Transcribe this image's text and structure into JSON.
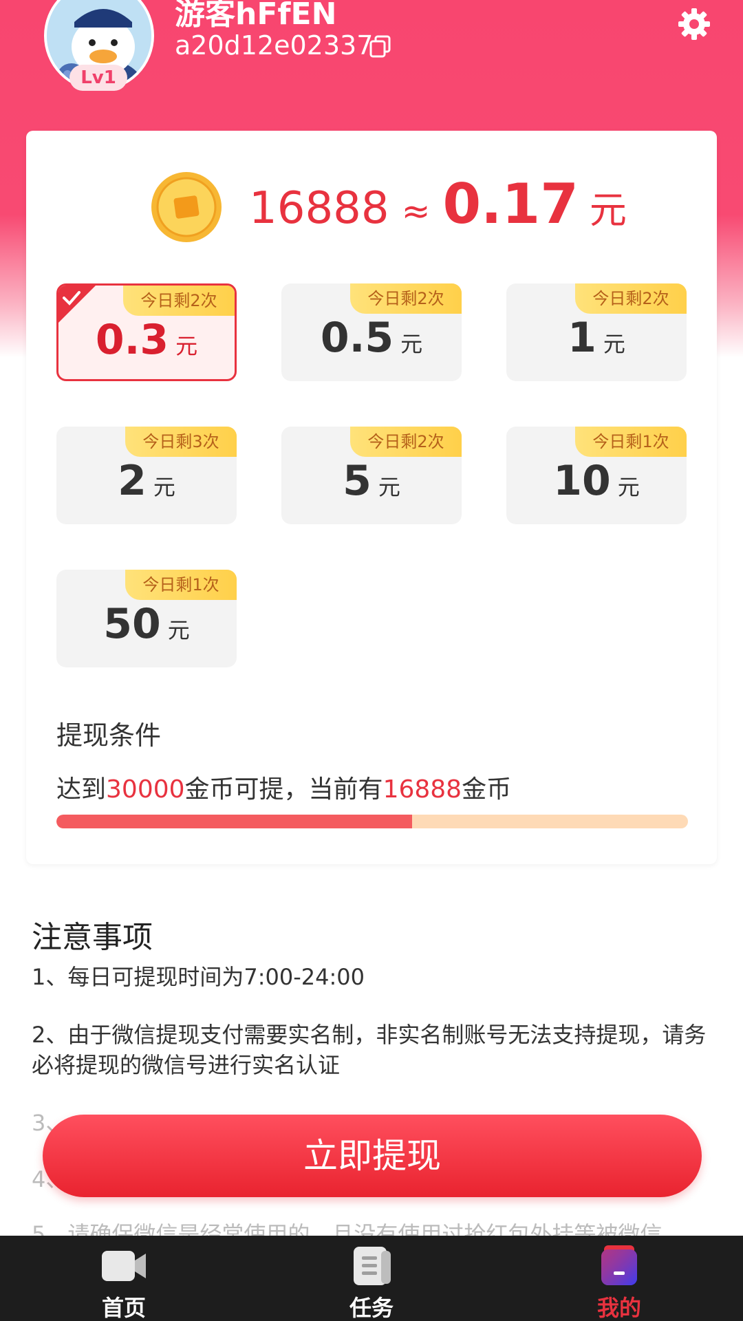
{
  "profile": {
    "username": "游客hFfEN",
    "user_id": "a20d12e02337",
    "level": "Lv1"
  },
  "balance": {
    "coins": "16888",
    "approx": "≈",
    "yuan": "0.17",
    "unit": "元"
  },
  "options": [
    {
      "amount": "0.3",
      "unit": "元",
      "tag": "今日剩2次",
      "selected": true
    },
    {
      "amount": "0.5",
      "unit": "元",
      "tag": "今日剩2次",
      "selected": false
    },
    {
      "amount": "1",
      "unit": "元",
      "tag": "今日剩2次",
      "selected": false
    },
    {
      "amount": "2",
      "unit": "元",
      "tag": "今日剩3次",
      "selected": false
    },
    {
      "amount": "5",
      "unit": "元",
      "tag": "今日剩2次",
      "selected": false
    },
    {
      "amount": "10",
      "unit": "元",
      "tag": "今日剩1次",
      "selected": false
    },
    {
      "amount": "50",
      "unit": "元",
      "tag": "今日剩1次",
      "selected": false
    }
  ],
  "condition": {
    "title": "提现条件",
    "prefix": "达到",
    "target": "30000",
    "middle": "金币可提，当前有",
    "current": "16888",
    "suffix": "金币",
    "progress_fraction": 0.563
  },
  "notes": {
    "title": "注意事项",
    "items": [
      "1、每日可提现时间为7:00-24:00",
      "2、由于微信提现支付需要实名制，非实名制账号无法支持提现，请务必将提现的微信号进行实名认证",
      "3、",
      "4、",
      "5、请确保微信是经常使用的，且没有使用过抢红包外挂等被微信"
    ]
  },
  "withdraw_button": "立即提现",
  "tabs": [
    {
      "label": "首页",
      "icon": "video-icon",
      "active": false
    },
    {
      "label": "任务",
      "icon": "document-icon",
      "active": false
    },
    {
      "label": "我的",
      "icon": "profile-icon",
      "active": true
    }
  ],
  "colors": {
    "brand": "#f8466f",
    "accent_red": "#e8323f",
    "progress_fill": "#f45b5f",
    "progress_track": "#fedab6",
    "tag_yellow": "#ffd04a"
  }
}
